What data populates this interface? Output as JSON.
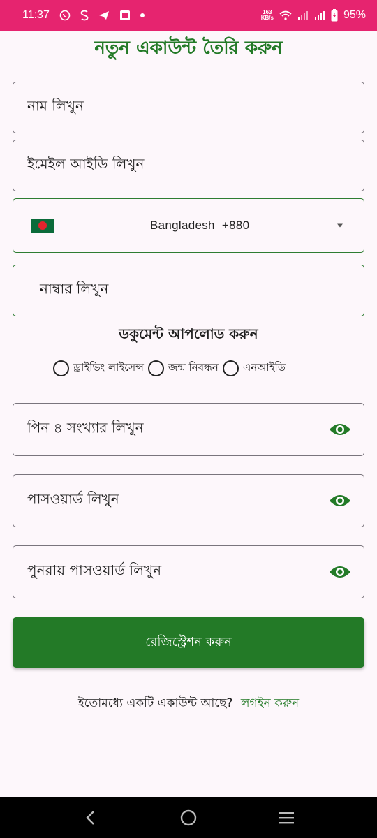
{
  "status_bar": {
    "time": "11:37",
    "net_speed_value": "163",
    "net_speed_unit": "KB/s",
    "battery": "95%",
    "background_color": "#e6246f"
  },
  "title": "নতুন একাউন্ট তৈরি করুন",
  "fields": {
    "name_placeholder": "নাম লিখুন",
    "email_placeholder": "ইমেইল আইডি লিখুন",
    "country_name": "Bangladesh",
    "country_code": "+880",
    "phone_placeholder": "নাম্বার লিখুন",
    "pin_placeholder": "পিন ৪ সংখ্যার লিখুন",
    "password_placeholder": "পাসওয়ার্ড লিখুন",
    "confirm_password_placeholder": "পুনরায় পাসওয়ার্ড লিখুন"
  },
  "document_section": {
    "title": "ডকুমেন্ট আপলোড করুন",
    "options": [
      "ড্রাইভিং লাইসেন্স",
      "জন্ম নিবন্ধন",
      "এনআইডি"
    ]
  },
  "register_button": "রেজিস্ট্রেশন করুন",
  "login_prompt": {
    "text": "ইতোমধ্যে একটি একাউন্ট আছে?",
    "link": "লগইন করুন"
  },
  "icons": {
    "flag": "bangladesh-flag-icon",
    "dropdown": "dropdown-caret-icon",
    "visibility": "eye-icon"
  },
  "colors": {
    "primary_green": "#237a27",
    "background": "#fdf7fb",
    "status_bar": "#e6246f"
  }
}
